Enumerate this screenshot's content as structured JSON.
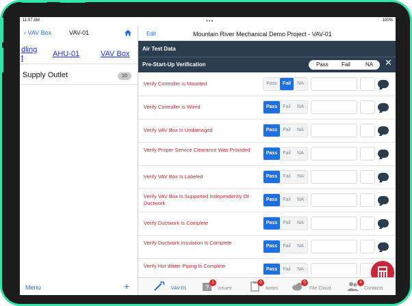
{
  "status": {
    "time": "11:07 AM",
    "battery": "100%"
  },
  "left": {
    "back_label": "VAV Box",
    "title": "VAV-01",
    "crumbs": [
      "dling",
      "t",
      "AHU-01",
      "VAV Box"
    ],
    "supply_label": "Supply Outlet",
    "supply_count": "10",
    "menu_label": "Menu",
    "add_label": "+"
  },
  "right": {
    "edit_label": "Edit",
    "project_title": "Mountain River Mechanical Demo Project - VAV-01",
    "section1": "Air Test Data",
    "section2": "Pre-Start-Up Verification",
    "filters": [
      "Pass",
      "Fail",
      "NA"
    ],
    "close": "✕",
    "rows": [
      {
        "label": "Verify Controller is Mounted",
        "selected": "Fail"
      },
      {
        "label": "Verify Controller is Wired",
        "selected": "Pass"
      },
      {
        "label": "Verify VAV Box Is Undamaged",
        "selected": "Pass"
      },
      {
        "label": "Verify Proper Service Clearance Was Provided",
        "selected": "Pass"
      },
      {
        "label": "Verify VAV Box Is Labeled",
        "selected": "Pass"
      },
      {
        "label": "Verify VAV Box Is Supported Independently Of Ductwork",
        "selected": "Pass"
      },
      {
        "label": "Verify Ductwork Is Complete",
        "selected": "Pass"
      },
      {
        "label": "Verify Ductwork Insulation Is Complete",
        "selected": "Pass"
      },
      {
        "label": "Verify Hot Water Piping Is Complete",
        "selected": "Pass"
      }
    ],
    "option_labels": [
      "Pass",
      "Fail",
      "NA"
    ]
  },
  "tabs": [
    {
      "label": "VAV-01",
      "badge": ""
    },
    {
      "label": "Issues",
      "badge": "1"
    },
    {
      "label": "Notes",
      "badge": "0"
    },
    {
      "label": "File Cloud",
      "badge": "0"
    },
    {
      "label": "Contacts",
      "badge": "4"
    }
  ],
  "colors": {
    "accent": "#1e6fe0",
    "header": "#2b3d51",
    "label_red": "#c0262d",
    "calc": "#c8263a",
    "frame": "#2ee6a8"
  }
}
